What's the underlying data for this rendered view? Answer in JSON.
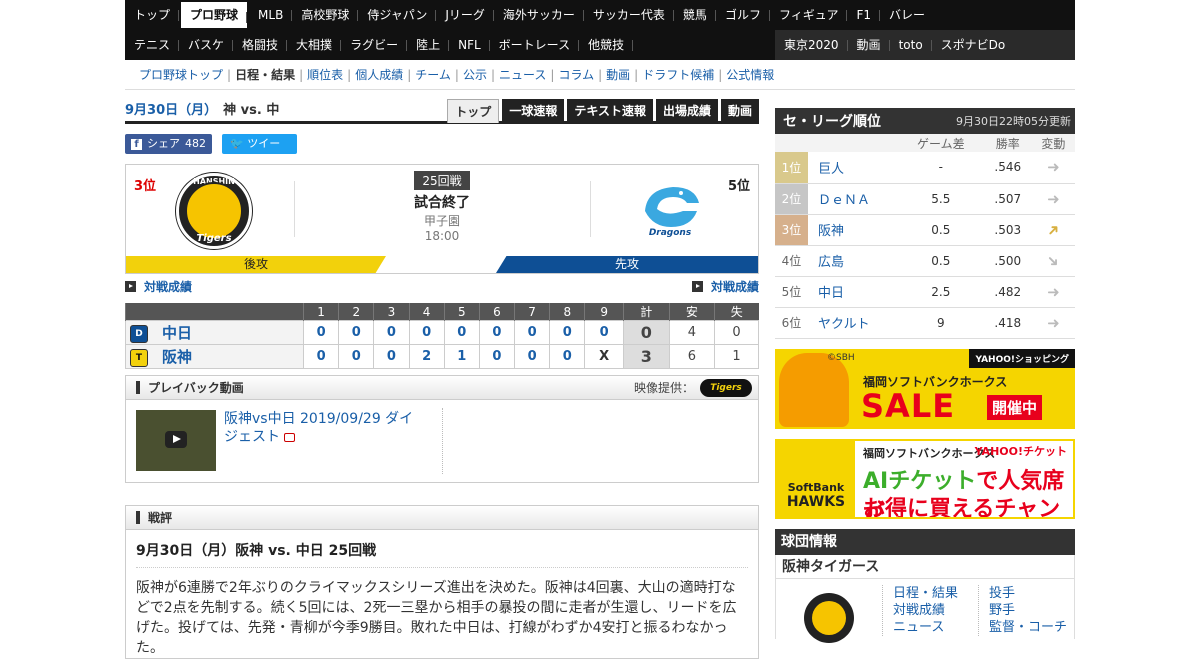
{
  "nav": {
    "row1": [
      "トップ",
      "プロ野球",
      "MLB",
      "高校野球",
      "侍ジャパン",
      "Jリーグ",
      "海外サッカー",
      "サッカー代表",
      "競馬",
      "ゴルフ",
      "フィギュア",
      "F1",
      "バレー"
    ],
    "row2": [
      "テニス",
      "バスケ",
      "格闘技",
      "大相撲",
      "ラグビー",
      "陸上",
      "NFL",
      "ボートレース",
      "他競技"
    ],
    "row2_right": [
      "東京2020",
      "動画",
      "toto",
      "スポナビDo"
    ]
  },
  "subnav": [
    "プロ野球トップ",
    "日程・結果",
    "順位表",
    "個人成績",
    "チーム",
    "公示",
    "ニュース",
    "コラム",
    "動画",
    "ドラフト候補",
    "公式情報"
  ],
  "game": {
    "date": "9月30日（月）",
    "matchup": "神 vs. 中",
    "tabs": [
      "トップ",
      "一球速報",
      "テキスト速報",
      "出場成績",
      "動画"
    ],
    "share_label": "シェア",
    "share_count": "482",
    "tweet_label": "ツイート",
    "home_rank": "3位",
    "away_rank": "5位",
    "home_logo_top": "HANSHIN",
    "home_logo_bottom": "Tigers",
    "away_logo_text": "Dragons",
    "round": "25回戦",
    "status": "試合終了",
    "venue": "甲子園",
    "time": "18:00",
    "home_side": "後攻",
    "away_side": "先攻",
    "h2h_label": "対戦成績"
  },
  "linescore": {
    "headers": [
      "1",
      "2",
      "3",
      "4",
      "5",
      "6",
      "7",
      "8",
      "9",
      "計",
      "安",
      "失"
    ],
    "rows": [
      {
        "team": "中日",
        "innings": [
          "0",
          "0",
          "0",
          "0",
          "0",
          "0",
          "0",
          "0",
          "0"
        ],
        "total": "0",
        "hits": "4",
        "errors": "0"
      },
      {
        "team": "阪神",
        "innings": [
          "0",
          "0",
          "0",
          "2",
          "1",
          "0",
          "0",
          "0",
          "X"
        ],
        "total": "3",
        "hits": "6",
        "errors": "1"
      }
    ]
  },
  "playback": {
    "title": "プレイバック動画",
    "provider_label": "映像提供：",
    "provider_logo": "Tigers",
    "video_title": "阪神vs中日 2019/09/29 ダイジェスト"
  },
  "review": {
    "label": "戦評",
    "title": "9月30日（月）阪神 vs. 中日 25回戦",
    "body": "阪神が6連勝で2年ぶりのクライマックスシリーズ進出を決めた。阪神は4回裏、大山の適時打などで2点を先制する。続く5回には、2死一三塁から相手の暴投の間に走者が生還し、リードを広げた。投げては、先発・青柳が今季9勝目。敗れた中日は、打線がわずか4安打と振るわなかった。"
  },
  "standings": {
    "title": "セ・リーグ順位",
    "updated": "9月30日22時05分更新",
    "headers": [
      "ゲーム差",
      "勝率",
      "変動"
    ],
    "rows": [
      {
        "rank": "1位",
        "team": "巨人",
        "gb": "-",
        "pct": ".546",
        "trend": "flat"
      },
      {
        "rank": "2位",
        "team": "ＤｅＮＡ",
        "gb": "5.5",
        "pct": ".507",
        "trend": "flat"
      },
      {
        "rank": "3位",
        "team": "阪神",
        "gb": "0.5",
        "pct": ".503",
        "trend": "up"
      },
      {
        "rank": "4位",
        "team": "広島",
        "gb": "0.5",
        "pct": ".500",
        "trend": "down"
      },
      {
        "rank": "5位",
        "team": "中日",
        "gb": "2.5",
        "pct": ".482",
        "trend": "flat"
      },
      {
        "rank": "6位",
        "team": "ヤクルト",
        "gb": "9",
        "pct": ".418",
        "trend": "flat"
      }
    ]
  },
  "ads": {
    "ad1_credit": "©SBH",
    "ad1_shop": "YAHOO!ショッピング",
    "ad1_team": "福岡ソフトバンクホークス",
    "ad1_sale": "SALE",
    "ad1_open": "開催中",
    "ad2_team": "福岡ソフトバンクホークス",
    "ad2_ticket": "YAHOO!チケット",
    "ad2_line1a": "AIチケット",
    "ad2_line1b": "で人気席が",
    "ad2_line2": "お得に買えるチャンス!",
    "ad2_logo1": "SoftBank",
    "ad2_logo2": "HAWKS"
  },
  "team_info": {
    "title": "球団情報",
    "name": "阪神タイガース",
    "links1": [
      "日程・結果",
      "対戦成績",
      "ニュース"
    ],
    "links2": [
      "投手",
      "野手",
      "監督・コーチ"
    ]
  }
}
